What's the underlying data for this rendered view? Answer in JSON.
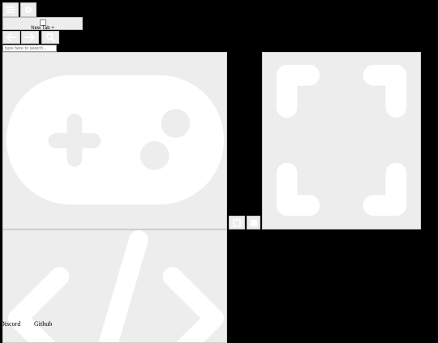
{
  "top_icons": [
    {
      "name": "menu-icon"
    },
    {
      "name": "settings-icon"
    }
  ],
  "tab": {
    "label": "New Tab +",
    "favicon_alt": "broken-image-icon"
  },
  "nav": {
    "back_icon": "back-arrow-icon",
    "forward_icon": "forward-arrow-icon",
    "search_icon": "search-icon"
  },
  "search": {
    "placeholder": "type here to search..."
  },
  "tiles": [
    {
      "name": "games-tile",
      "icon": "gamepad-icon"
    },
    {
      "name": "fullscreen-tile",
      "icon": "fullscreen-icon"
    },
    {
      "name": "code-tile",
      "icon": "code-icon"
    }
  ],
  "small_buttons": [
    {
      "name": "small-button-1"
    },
    {
      "name": "small-button-2"
    }
  ],
  "footer": {
    "discord": "Discord",
    "github": "Github"
  },
  "colors": {
    "background": "#000000",
    "tile": "#ededed",
    "glyph": "#ffffff"
  }
}
